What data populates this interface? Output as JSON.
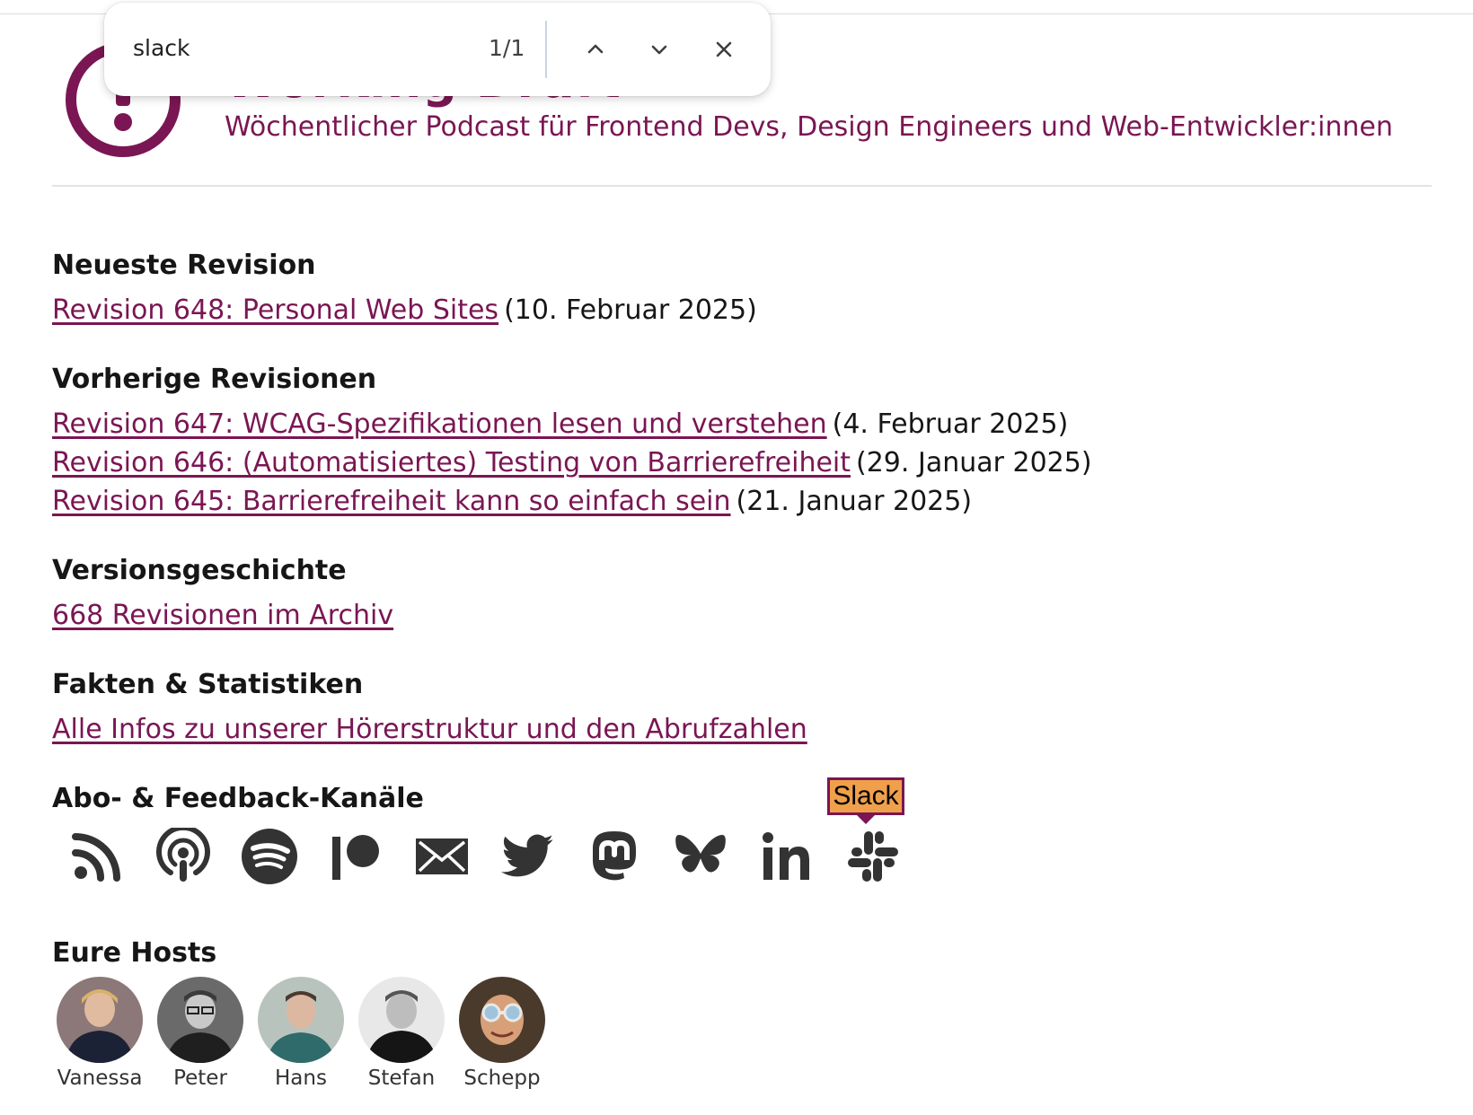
{
  "header": {
    "title_partial": "Working Draft",
    "subtitle": "Wöchentlicher Podcast für Frontend Devs, Design Engineers und Web-Entwickler:innen"
  },
  "find_bar": {
    "query": "slack",
    "count": "1/1"
  },
  "sections": {
    "latest": {
      "heading": "Neueste Revision",
      "items": [
        {
          "link": "Revision 648: Personal Web Sites",
          "date": "(10. Februar 2025)"
        }
      ]
    },
    "previous": {
      "heading": "Vorherige Revisionen",
      "items": [
        {
          "link": "Revision 647: WCAG-Spezifikationen lesen und verstehen",
          "date": "(4. Februar 2025)"
        },
        {
          "link": "Revision 646: (Automatisiertes) Testing von Barrierefreiheit",
          "date": "(29. Januar 2025)"
        },
        {
          "link": "Revision 645: Barrierefreiheit kann so einfach sein",
          "date": "(21. Januar 2025)"
        }
      ]
    },
    "history": {
      "heading": "Versionsgeschichte",
      "link": "668 Revisionen im Archiv"
    },
    "facts": {
      "heading": "Fakten & Statistiken",
      "link": "Alle Infos zu unserer Hörerstruktur und den Abrufzahlen"
    },
    "channels": {
      "heading": "Abo- & Feedback-Kanäle",
      "icons": [
        "rss-icon",
        "podcast-icon",
        "spotify-icon",
        "patreon-icon",
        "mail-icon",
        "twitter-icon",
        "mastodon-icon",
        "bluesky-icon",
        "linkedin-icon",
        "slack-icon"
      ],
      "tooltip": "Slack"
    },
    "hosts": {
      "heading": "Eure Hosts",
      "names": [
        "Vanessa",
        "Peter",
        "Hans",
        "Stefan",
        "Schepp"
      ]
    }
  },
  "colors": {
    "brand": "#7a1653",
    "icon": "#333333",
    "highlight": "#f0a04b"
  }
}
